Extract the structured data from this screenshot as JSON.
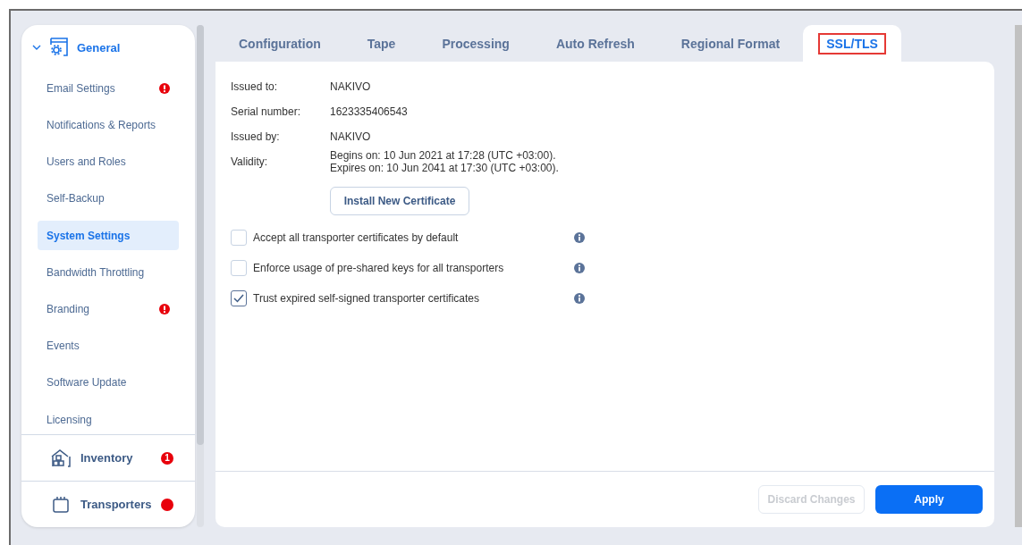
{
  "sidebar": {
    "section": {
      "label": "General",
      "expanded": true
    },
    "items": [
      {
        "label": "Email Settings",
        "selected": false,
        "kind": "alert"
      },
      {
        "label": "Notifications & Reports",
        "selected": false,
        "kind": "plain"
      },
      {
        "label": "Users and Roles",
        "selected": false,
        "kind": "plain"
      },
      {
        "label": "Self-Backup",
        "selected": false,
        "kind": "plain"
      },
      {
        "label": "System Settings",
        "selected": true,
        "kind": "plain"
      },
      {
        "label": "Bandwidth Throttling",
        "selected": false,
        "kind": "plain"
      },
      {
        "label": "Branding",
        "selected": false,
        "kind": "alert"
      },
      {
        "label": "Events",
        "selected": false,
        "kind": "plain"
      },
      {
        "label": "Software Update",
        "selected": false,
        "kind": "plain"
      },
      {
        "label": "Licensing",
        "selected": false,
        "kind": "plain"
      }
    ],
    "groups": [
      {
        "label": "Inventory",
        "kind": "inventory",
        "badge": true,
        "badge_count": "1"
      },
      {
        "label": "Transporters",
        "kind": "transporters",
        "badge": true
      }
    ]
  },
  "tabs": [
    {
      "label": "Configuration",
      "selected": false
    },
    {
      "label": "Tape",
      "selected": false
    },
    {
      "label": "Processing",
      "selected": false
    },
    {
      "label": "Auto Refresh",
      "selected": false
    },
    {
      "label": "Regional Format",
      "selected": false
    },
    {
      "label": "SSL/TLS",
      "selected": true
    }
  ],
  "certificate": [
    {
      "label": "Issued to:",
      "values": [
        "NAKIVO"
      ]
    },
    {
      "label": "Serial number:",
      "values": [
        "1623335406543"
      ]
    },
    {
      "label": "Issued by:",
      "values": [
        "NAKIVO"
      ]
    },
    {
      "label": "Validity:",
      "values": [
        "Begins on: 10 Jun 2021 at 17:28 (UTC +03:00).",
        "Expires on: 10 Jun 2041 at 17:30 (UTC +03:00)."
      ]
    }
  ],
  "install_button": "Install New Certificate",
  "options": [
    {
      "label": "Accept all transporter certificates by default",
      "checked": false
    },
    {
      "label": "Enforce usage of pre-shared keys for all transporters",
      "checked": false
    },
    {
      "label": "Trust expired self-signed transporter certificates",
      "checked": true
    }
  ],
  "footer": {
    "discard": {
      "label": "Discard Changes",
      "disabled": true
    },
    "apply": {
      "label": "Apply",
      "disabled": false
    }
  }
}
